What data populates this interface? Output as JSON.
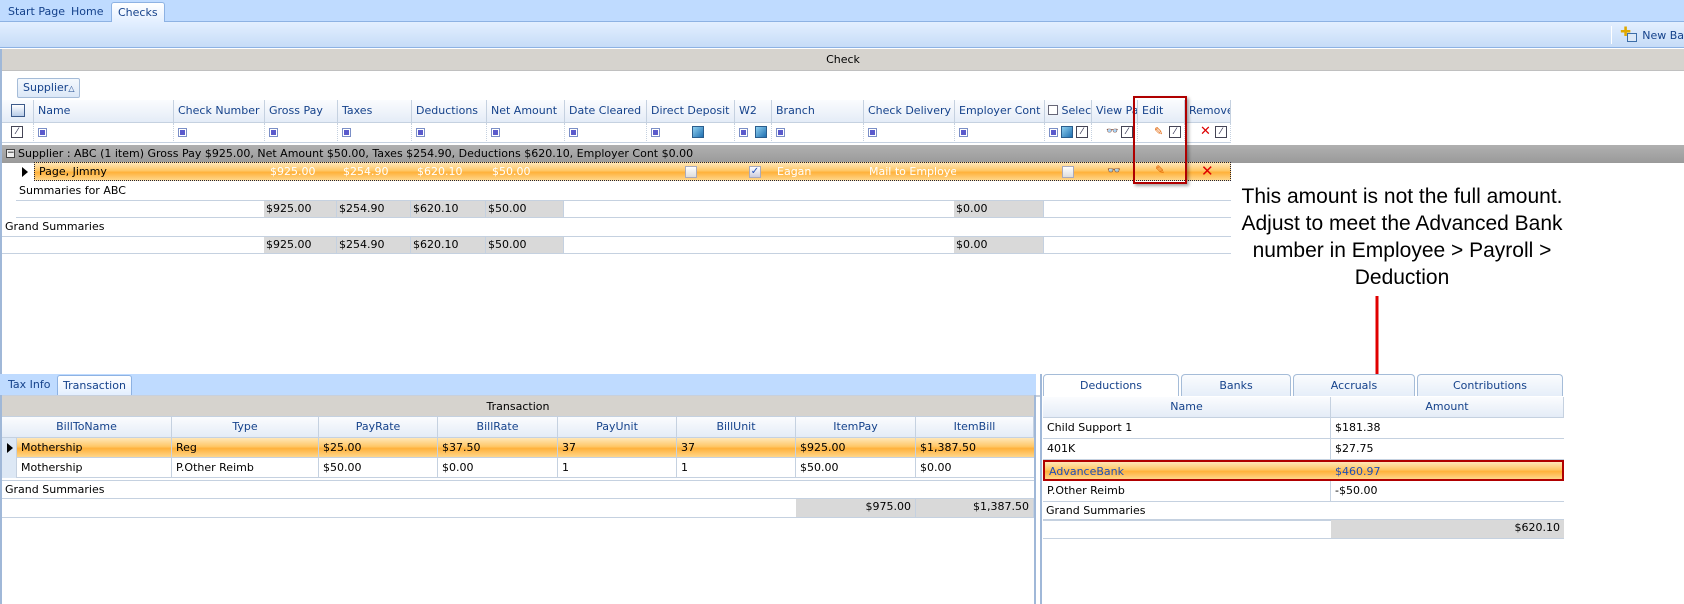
{
  "tabs": [
    {
      "label": "Start Page",
      "active": false
    },
    {
      "label": "Home",
      "active": false
    },
    {
      "label": "Checks",
      "active": true
    }
  ],
  "toolbar": {
    "new_batch_label": "New Ba"
  },
  "check_grid": {
    "title": "Check",
    "group_button": "Supplier",
    "columns": [
      "Name",
      "Check Number",
      "Gross Pay",
      "Taxes",
      "Deductions",
      "Net Amount",
      "Date Cleared",
      "Direct Deposit",
      "W2",
      "Branch",
      "Check Delivery",
      "Employer Cont",
      "Selec",
      "View Pa",
      "Edit",
      "Remove"
    ],
    "group_row": "Supplier : ABC (1 item) Gross Pay $925.00, Net Amount $50.00, Taxes $254.90, Deductions $620.10, Employer Cont $0.00",
    "rows": [
      {
        "name": "Page, Jimmy",
        "check_number": "",
        "gross_pay": "$925.00",
        "taxes": "$254.90",
        "deductions": "$620.10",
        "net_amount": "$50.00",
        "date_cleared": "",
        "direct_deposit": false,
        "w2": true,
        "branch": "Eagan",
        "check_delivery": "Mail to Employee",
        "employer_cont": "",
        "selected": false
      }
    ],
    "group_summary_label": "Summaries for ABC",
    "group_summary": {
      "gross_pay": "$925.00",
      "taxes": "$254.90",
      "deductions": "$620.10",
      "net_amount": "$50.00",
      "employer_cont": "$0.00"
    },
    "grand_summary_label": "Grand Summaries",
    "grand_summary": {
      "gross_pay": "$925.00",
      "taxes": "$254.90",
      "deductions": "$620.10",
      "net_amount": "$50.00",
      "employer_cont": "$0.00"
    }
  },
  "annotation": {
    "note": "This amount is not the full amount. Adjust to meet the Advanced Bank number in Employee > Payroll > Deduction",
    "color": "#b00000"
  },
  "lower_tabs": [
    {
      "label": "Tax Info",
      "active": false
    },
    {
      "label": "Transaction",
      "active": true
    }
  ],
  "transaction_grid": {
    "title": "Transaction",
    "columns": [
      "BillToName",
      "Type",
      "PayRate",
      "BillRate",
      "PayUnit",
      "BillUnit",
      "ItemPay",
      "ItemBill"
    ],
    "rows": [
      [
        "Mothership",
        "Reg",
        "$25.00",
        "$37.50",
        "37",
        "37",
        "$925.00",
        "$1,387.50"
      ],
      [
        "Mothership",
        "P.Other Reimb",
        "$50.00",
        "$0.00",
        "1",
        "1",
        "$50.00",
        "$0.00"
      ]
    ],
    "grand_summary_label": "Grand Summaries",
    "grand_summary": {
      "item_pay": "$975.00",
      "item_bill": "$1,387.50"
    }
  },
  "right_tabs": [
    {
      "label": "Deductions",
      "active": true
    },
    {
      "label": "Banks",
      "active": false
    },
    {
      "label": "Accruals",
      "active": false
    },
    {
      "label": "Contributions",
      "active": false
    }
  ],
  "deductions_grid": {
    "columns": [
      "Name",
      "Amount"
    ],
    "rows": [
      [
        "Child Support 1",
        "$181.38"
      ],
      [
        "401K",
        "$27.75"
      ],
      [
        "AdvanceBank",
        "$460.97"
      ],
      [
        "P.Other Reimb",
        "-$50.00"
      ]
    ],
    "grand_summary_label": "Grand Summaries",
    "grand_summary": {
      "amount": "$620.10"
    }
  },
  "colors": {
    "accent": "#15428b",
    "selection": "#ffc766",
    "annotation": "#b00000",
    "tab_bar": "#bfdbff"
  }
}
